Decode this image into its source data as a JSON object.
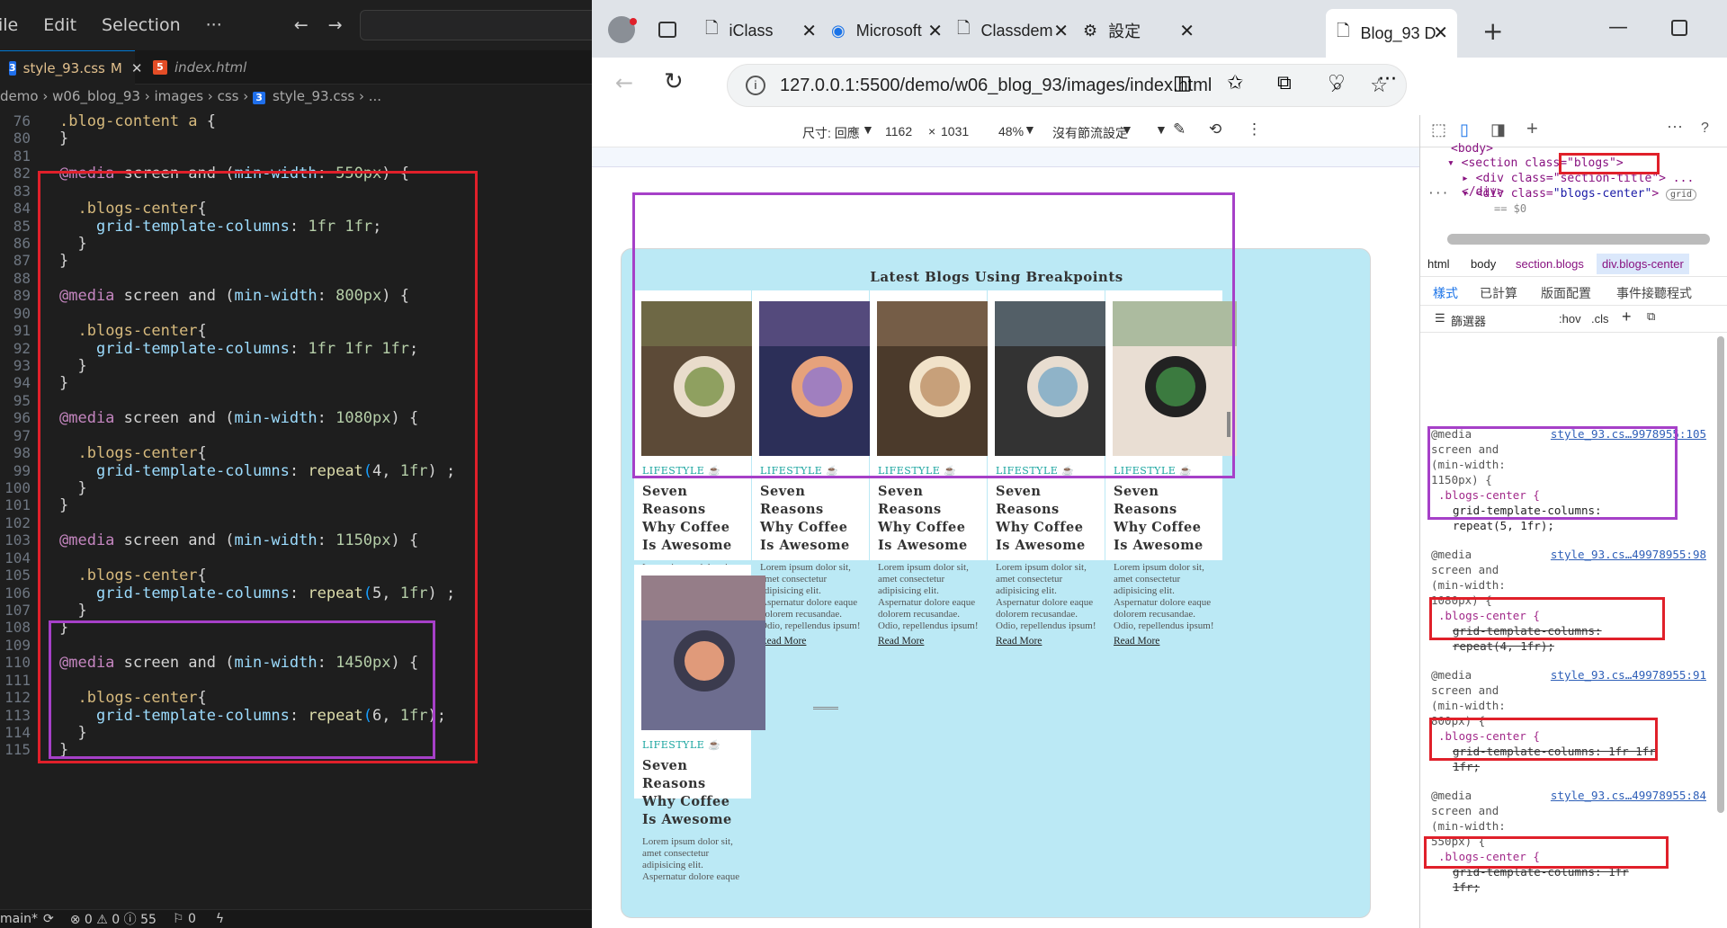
{
  "vscode": {
    "menu": [
      "ile",
      "Edit",
      "Selection",
      "···"
    ],
    "tabs": [
      {
        "label": "style_93.css",
        "badge": "M",
        "active": true
      },
      {
        "label": "index.html",
        "active": false
      }
    ],
    "breadcrumb": [
      "demo",
      "w06_blog_93",
      "images",
      "css",
      "style_93.css",
      "..."
    ],
    "lines": [
      {
        "n": "76",
        "text": ".blog-content a {"
      },
      {
        "n": "80",
        "text": "}"
      },
      {
        "n": "81",
        "text": ""
      },
      {
        "n": "82",
        "text": "@media screen and (min-width: 550px) {"
      },
      {
        "n": "83",
        "text": ""
      },
      {
        "n": "84",
        "text": "  .blogs-center{"
      },
      {
        "n": "85",
        "text": "    grid-template-columns: 1fr 1fr;"
      },
      {
        "n": "86",
        "text": "  }"
      },
      {
        "n": "87",
        "text": "}"
      },
      {
        "n": "88",
        "text": ""
      },
      {
        "n": "89",
        "text": "@media screen and (min-width: 800px) {"
      },
      {
        "n": "90",
        "text": ""
      },
      {
        "n": "91",
        "text": "  .blogs-center{"
      },
      {
        "n": "92",
        "text": "    grid-template-columns: 1fr 1fr 1fr;"
      },
      {
        "n": "93",
        "text": "  }"
      },
      {
        "n": "94",
        "text": "}"
      },
      {
        "n": "95",
        "text": ""
      },
      {
        "n": "96",
        "text": "@media screen and (min-width: 1080px) {"
      },
      {
        "n": "97",
        "text": ""
      },
      {
        "n": "98",
        "text": "  .blogs-center{"
      },
      {
        "n": "99",
        "text": "    grid-template-columns: repeat(4, 1fr) ;"
      },
      {
        "n": "100",
        "text": "  }"
      },
      {
        "n": "101",
        "text": "}"
      },
      {
        "n": "102",
        "text": ""
      },
      {
        "n": "103",
        "text": "@media screen and (min-width: 1150px) {"
      },
      {
        "n": "104",
        "text": ""
      },
      {
        "n": "105",
        "text": "  .blogs-center{"
      },
      {
        "n": "106",
        "text": "    grid-template-columns: repeat(5, 1fr) ;"
      },
      {
        "n": "107",
        "text": "  }"
      },
      {
        "n": "108",
        "text": "}"
      },
      {
        "n": "109",
        "text": ""
      },
      {
        "n": "110",
        "text": "@media screen and (min-width: 1450px) {"
      },
      {
        "n": "111",
        "text": ""
      },
      {
        "n": "112",
        "text": "  .blogs-center{"
      },
      {
        "n": "113",
        "text": "    grid-template-columns: repeat(6, 1fr);"
      },
      {
        "n": "114",
        "text": "  }"
      },
      {
        "n": "115",
        "text": "}"
      }
    ],
    "status": {
      "branch": "main*",
      "errors": "0",
      "warnings": "0",
      "info": "55",
      "ports": "0"
    }
  },
  "browser": {
    "tabs": [
      "iClass",
      "Microsoft",
      "Classdem",
      "設定",
      "Blog_93 D"
    ],
    "url": "127.0.0.1:5500/demo/w06_blog_93/images/index.html",
    "device": {
      "size_label": "尺寸: 回應",
      "width": "1162",
      "x": "×",
      "height": "1031",
      "zoom": "48%",
      "throttle": "沒有節流設定"
    },
    "page": {
      "title": "Latest Blogs Using Breakpoints",
      "cards": [
        {
          "category": "LIFESTYLE",
          "title": "Seven Reasons Why Coffee Is Awesome",
          "text": "Lorem ipsum dolor sit, amet consectetur adipisicing elit. Aspernatur dolore eaque dolorem recusandae. Odio, repellendus ipsum!",
          "link": "Read More"
        },
        {
          "category": "LIFESTYLE",
          "title": "Seven Reasons Why Coffee Is Awesome",
          "text": "Lorem ipsum dolor sit, amet consectetur adipisicing elit. Aspernatur dolore eaque dolorem recusandae. Odio, repellendus ipsum!",
          "link": "Read More"
        },
        {
          "category": "LIFESTYLE",
          "title": "Seven Reasons Why Coffee Is Awesome",
          "text": "Lorem ipsum dolor sit, amet consectetur adipisicing elit. Aspernatur dolore eaque dolorem recusandae. Odio, repellendus ipsum!",
          "link": "Read More"
        },
        {
          "category": "LIFESTYLE",
          "title": "Seven Reasons Why Coffee Is Awesome",
          "text": "Lorem ipsum dolor sit, amet consectetur adipisicing elit. Aspernatur dolore eaque dolorem recusandae. Odio, repellendus ipsum!",
          "link": "Read More"
        },
        {
          "category": "LIFESTYLE",
          "title": "Seven Reasons Why Coffee Is Awesome",
          "text": "Lorem ipsum dolor sit, amet consectetur adipisicing elit. Aspernatur dolore eaque dolorem recusandae. Odio, repellendus ipsum!",
          "link": "Read More"
        },
        {
          "category": "LIFESTYLE",
          "title": "Seven Reasons Why Coffee Is Awesome",
          "text": "Lorem ipsum dolor sit, amet consectetur adipisicing elit. Aspernatur dolore eaque",
          "link": ""
        }
      ]
    },
    "devtools": {
      "dom": {
        "body": "<body>",
        "section": "<section class=\"blogs\">",
        "div_title": "<div class=\"section-title\"> ... </div>",
        "div_center_open": "<div class=",
        "div_center_class": "\"blogs-center\"",
        "grid_badge": "grid",
        "dollar0": "== $0"
      },
      "crumbs": [
        "html",
        "body",
        "section.blogs",
        "div.blogs-center"
      ],
      "style_tabs": [
        "樣式",
        "已計算",
        "版面配置",
        "事件接聽程式"
      ],
      "filter": {
        "label": "篩選器",
        "hov": ":hov",
        "cls": ".cls"
      },
      "rules": [
        {
          "media": "@media screen and (min-width: 1150px) {",
          "src": "style_93.cs…9978955:105",
          "selector": ".blogs-center {",
          "decl": "grid-template-columns: repeat(5, 1fr);",
          "struck": false
        },
        {
          "media": "@media screen and (min-width: 1080px) {",
          "src": "style_93.cs…49978955:98",
          "selector": ".blogs-center {",
          "decl": "grid-template-columns: repeat(4, 1fr);",
          "struck": true
        },
        {
          "media": "@media screen and (min-width: 800px) {",
          "src": "style_93.cs…49978955:91",
          "selector": ".blogs-center {",
          "decl": "grid-template-columns: 1fr 1fr 1fr;",
          "struck": true
        },
        {
          "media": "@media screen and (min-width: 550px) {",
          "src": "style_93.cs…49978955:84",
          "selector": ".blogs-center {",
          "decl": "grid-template-columns: 1fr 1fr;",
          "struck": true
        }
      ]
    }
  },
  "colors": {
    "highlight_red": "#e0202a",
    "highlight_purple": "#a640c8",
    "page_bg": "#bbe9f5",
    "category": "#1aa5a0"
  }
}
